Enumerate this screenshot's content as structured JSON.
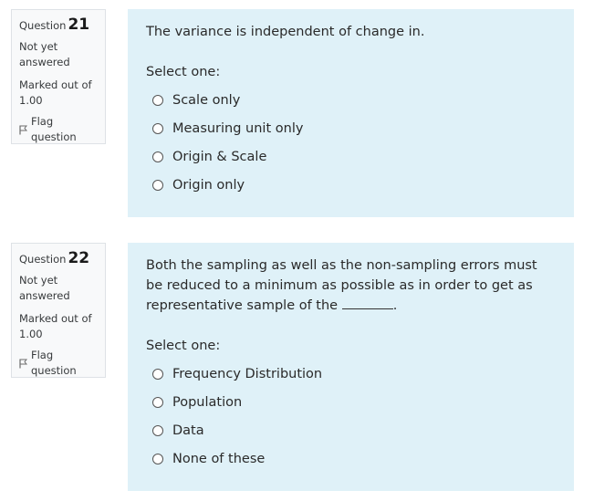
{
  "questions": [
    {
      "label": "Question",
      "number": "21",
      "state": "Not yet answered",
      "marked_out_of": "Marked out of 1.00",
      "flag_label": "Flag question",
      "text": "The variance is independent of change in.",
      "text_blank_suffix": "",
      "prompt": "Select one:",
      "options": [
        "Scale only",
        "Measuring unit only",
        "Origin & Scale",
        "Origin only"
      ]
    },
    {
      "label": "Question",
      "number": "22",
      "state": "Not yet answered",
      "marked_out_of": "Marked out of 1.00",
      "flag_label": "Flag question",
      "text": "Both the sampling as well as the non-sampling errors must be reduced to a minimum as possible as in order to get as representative sample of the",
      "text_blank_suffix": ".",
      "prompt": "Select one:",
      "options": [
        "Frequency Distribution",
        "Population",
        "Data",
        "None of these"
      ]
    }
  ],
  "colors": {
    "info_bg": "#f8f9fa",
    "content_bg": "#dff1f8"
  }
}
